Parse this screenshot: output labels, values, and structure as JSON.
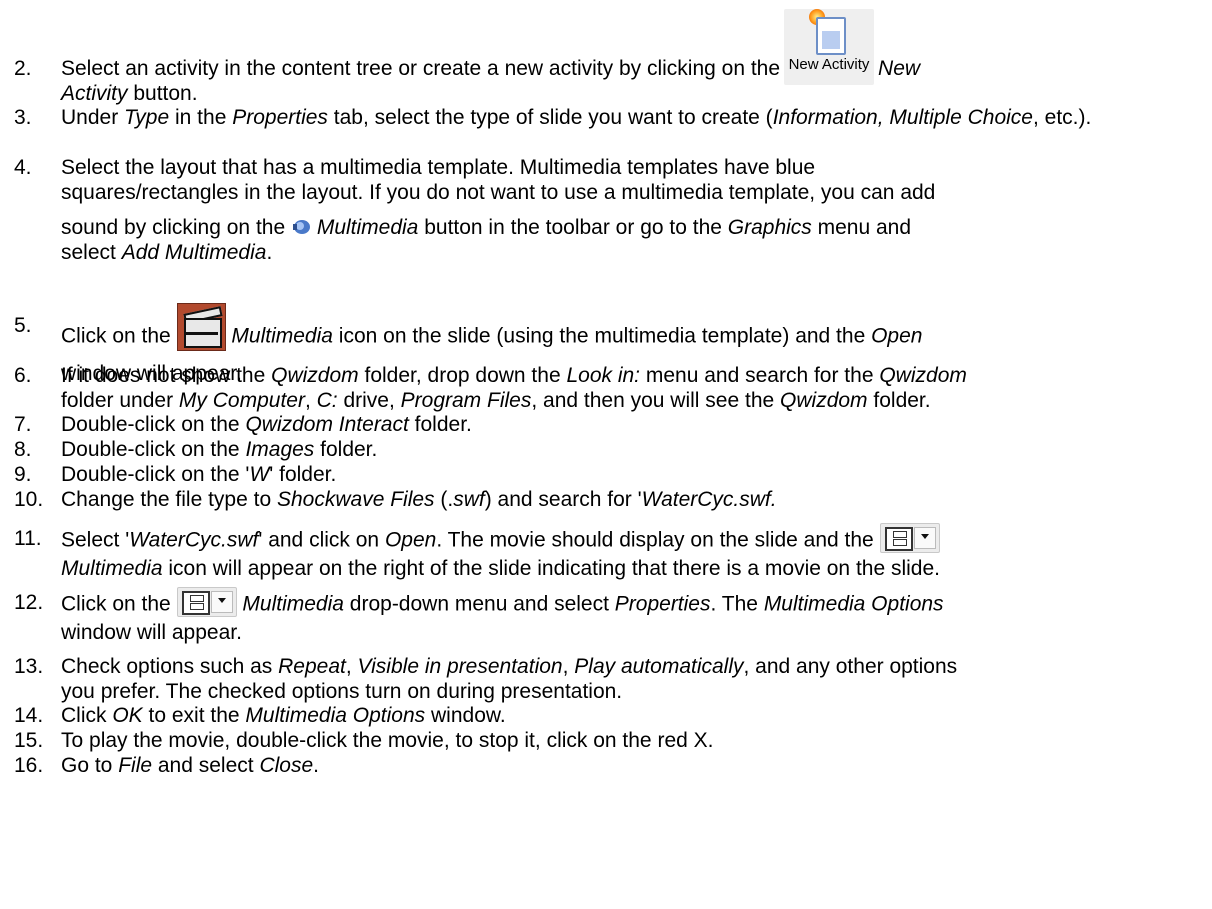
{
  "new_activity_button": {
    "label": "New Activity",
    "icon": "new-activity-icon"
  },
  "steps": [
    {
      "num": "2.",
      "line1": "Select an activity in the content tree or create a new activity by clicking on the",
      "line1b": "New",
      "line2a": "Activity",
      "line2b": " button."
    },
    {
      "num": "3.",
      "a": "Under ",
      "b": "Type",
      "c": " in the ",
      "d": "Properties",
      "e": " tab, select the type of slide you want to create (",
      "f": "Information, Multiple Choice",
      "g": ", etc.)."
    },
    {
      "num": "4.",
      "line1": "Select the layout that has a multimedia template.  Multimedia templates have blue",
      "line2": "squares/rectangles in the layout.  If you do not want to use a multimedia template, you can add",
      "line3a": "sound by clicking on the ",
      "line3b": "Multimedia",
      "line3c": " button in the toolbar or go to the ",
      "line3d": "Graphics",
      "line3e": " menu and",
      "line4a": "select ",
      "line4b": "Add Multimedia",
      "line4c": "."
    },
    {
      "num": "5.",
      "a": "Click on the ",
      "b": "Multimedia",
      "c": " icon on the slide (using the multimedia template) and the ",
      "d": "Open",
      "e": "window will appear."
    },
    {
      "num": "6.",
      "a": "If it does not show the ",
      "b": "Qwizdom",
      "c": " folder, drop down the ",
      "d": "Look in:",
      "e": " menu and search for the ",
      "f": "Qwizdom",
      "g": "folder under ",
      "h": "My Computer",
      "i": ", ",
      "j": "C:",
      "k": " drive, ",
      "l": "Program Files",
      "m": ", and then you will see the ",
      "n": "Qwizdom",
      "o": " folder."
    },
    {
      "num": "7.",
      "a": "Double-click on the ",
      "b": "Qwizdom Interact",
      "c": " folder."
    },
    {
      "num": "8.",
      "a": "Double-click on the ",
      "b": "Images",
      "c": " folder."
    },
    {
      "num": "9.",
      "a": "Double-click on the '",
      "b": "W",
      "c": "' folder."
    },
    {
      "num": "10.",
      "a": "Change the file type to ",
      "b": "Shockwave Files",
      "c": " (.",
      "d": "swf",
      "e": ") and search for '",
      "f": "WaterCyc.swf."
    },
    {
      "num": "11.",
      "a": "Select '",
      "b": "WaterCyc.swf",
      "c": "' and click on ",
      "d": "Open",
      "e": ".  The movie should display on the slide and the",
      "f": "Multimedia",
      "g": " icon will appear on the right of the slide indicating that there is a movie on the slide."
    },
    {
      "num": "12.",
      "a": "Click on the ",
      "b": "Multimedia",
      "c": " drop-down menu and select ",
      "d": "Properties",
      "e": ".  The ",
      "f": "Multimedia Options",
      "g": "window will appear."
    },
    {
      "num": "13.",
      "a": "Check options such as ",
      "b": "Repeat",
      "c": ", ",
      "d": "Visible in presentation",
      "e": ", ",
      "f": "Play automatically",
      "g": ", and any other options",
      "h": "you prefer.  The checked options turn on during presentation."
    },
    {
      "num": "14.",
      "a": "Click ",
      "b": "OK",
      "c": " to exit the ",
      "d": "Multimedia Options",
      "e": " window."
    },
    {
      "num": "15.",
      "a": "To play the movie, double-click the movie, to stop it, click on the red X."
    },
    {
      "num": "16.",
      "a": "Go to ",
      "b": "File",
      "c": " and select ",
      "d": "Close",
      "e": "."
    }
  ],
  "icons": [
    "new-activity-icon",
    "multimedia-speaker-icon",
    "multimedia-clapper-icon",
    "film-strip-dropdown-icon"
  ]
}
